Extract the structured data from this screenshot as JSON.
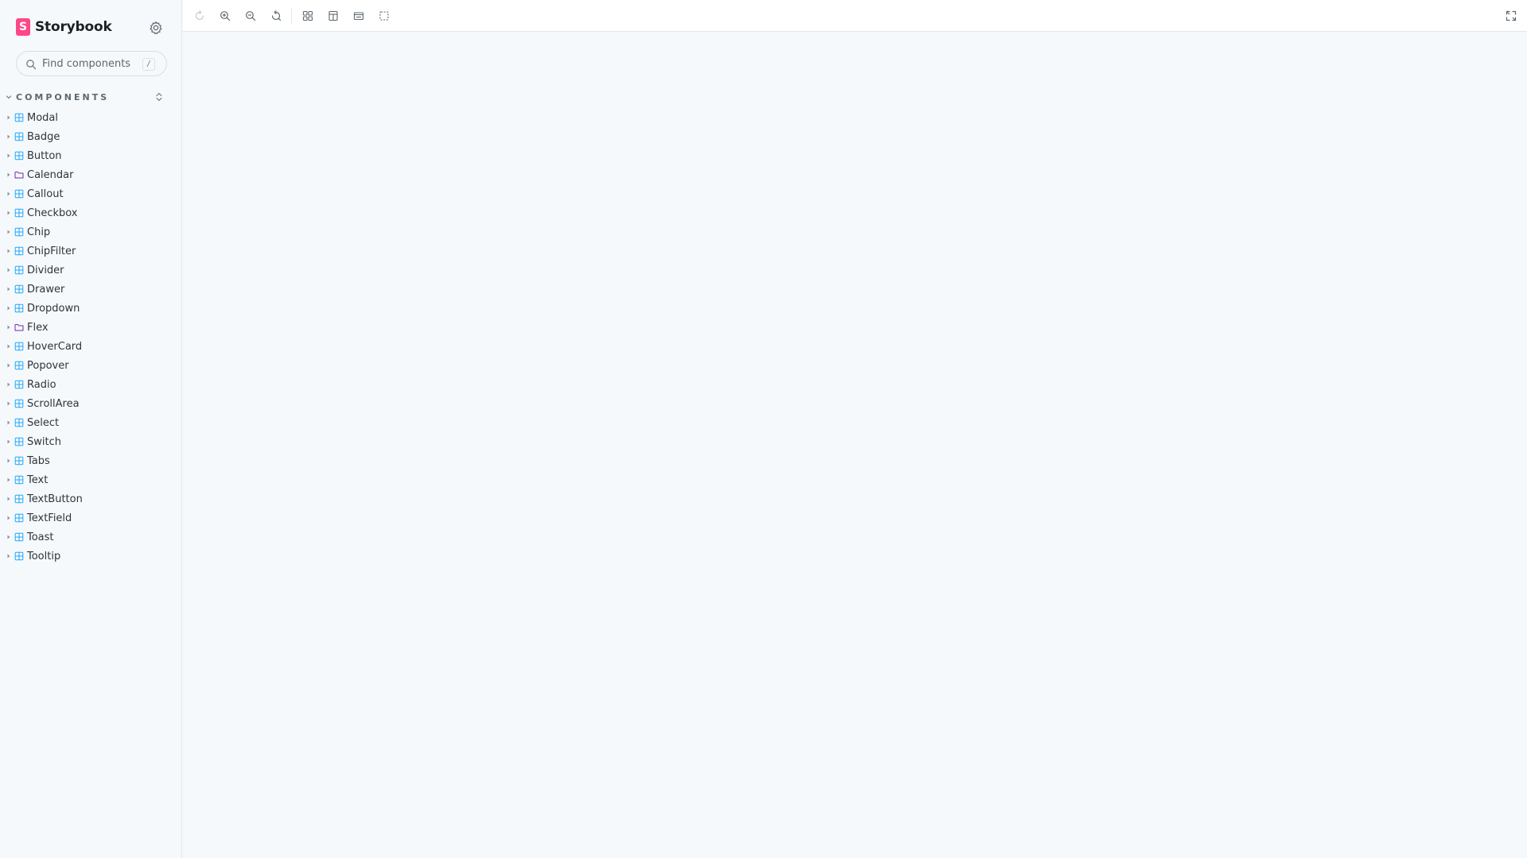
{
  "app": {
    "brand_name": "Storybook",
    "logo_letter": "S",
    "accent_color": "#FF4785",
    "component_icon_color": "#1EA7FD",
    "folder_icon_color": "#6F2CAC"
  },
  "search": {
    "placeholder": "Find components",
    "shortcut": "/"
  },
  "sidebar": {
    "section_title": "COMPONENTS",
    "items": [
      {
        "label": "Modal",
        "icon": "component-icon"
      },
      {
        "label": "Badge",
        "icon": "component-icon"
      },
      {
        "label": "Button",
        "icon": "component-icon"
      },
      {
        "label": "Calendar",
        "icon": "folder-icon"
      },
      {
        "label": "Callout",
        "icon": "component-icon"
      },
      {
        "label": "Checkbox",
        "icon": "component-icon"
      },
      {
        "label": "Chip",
        "icon": "component-icon"
      },
      {
        "label": "ChipFilter",
        "icon": "component-icon"
      },
      {
        "label": "Divider",
        "icon": "component-icon"
      },
      {
        "label": "Drawer",
        "icon": "component-icon"
      },
      {
        "label": "Dropdown",
        "icon": "component-icon"
      },
      {
        "label": "Flex",
        "icon": "folder-icon"
      },
      {
        "label": "HoverCard",
        "icon": "component-icon"
      },
      {
        "label": "Popover",
        "icon": "component-icon"
      },
      {
        "label": "Radio",
        "icon": "component-icon"
      },
      {
        "label": "ScrollArea",
        "icon": "component-icon"
      },
      {
        "label": "Select",
        "icon": "component-icon"
      },
      {
        "label": "Switch",
        "icon": "component-icon"
      },
      {
        "label": "Tabs",
        "icon": "component-icon"
      },
      {
        "label": "Text",
        "icon": "component-icon"
      },
      {
        "label": "TextButton",
        "icon": "component-icon"
      },
      {
        "label": "TextField",
        "icon": "component-icon"
      },
      {
        "label": "Toast",
        "icon": "component-icon"
      },
      {
        "label": "Tooltip",
        "icon": "component-icon"
      }
    ]
  },
  "toolbar": {
    "tools": [
      {
        "name": "reload-icon",
        "state": "disabled"
      },
      {
        "name": "zoom-in-icon"
      },
      {
        "name": "zoom-out-icon"
      },
      {
        "name": "reset-zoom-icon"
      },
      {
        "name": "grid-icon"
      },
      {
        "name": "background-icon"
      },
      {
        "name": "viewport-icon"
      },
      {
        "name": "outline-icon"
      },
      {
        "name": "fullscreen-icon"
      }
    ]
  }
}
